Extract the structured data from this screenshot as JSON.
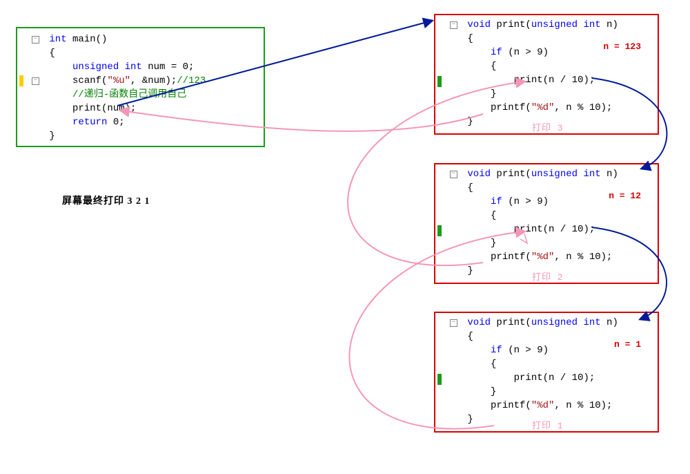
{
  "main": {
    "sig_kw": "int",
    "sig_name": " main()",
    "l_open": "{",
    "l1_a": "unsigned int",
    "l1_b": " num = 0;",
    "l2_a": "scanf",
    "l2_b": "(",
    "l2_c": "\"%u\"",
    "l2_d": ", &num);",
    "l2_e": "//123",
    "l3": "//递归-函数自己调用自己",
    "l4": "print(num);",
    "l5_a": "return",
    "l5_b": " 0;",
    "l_close": "}"
  },
  "print_fn": {
    "sig_kw1": "void",
    "sig_name": " print(",
    "sig_kw2": "unsigned int",
    "sig_tail": " n)",
    "l_open": "{",
    "l1_a": "if",
    "l1_b": " (n > 9)",
    "l2": "{",
    "l3": "print(n / 10);",
    "l4": "}",
    "l5_a": "printf(",
    "l5_b": "\"%d\"",
    "l5_c": ", n % 10);",
    "l_close": "}"
  },
  "annot": {
    "n1": "n = 123",
    "n2": "n = 12",
    "n3": "n = 1",
    "p1": "打印 3",
    "p2": "打印 2",
    "p3": "打印 1",
    "final": "屏幕最终打印 3 2 1"
  },
  "fold_glyph": "−",
  "colors": {
    "green_border": "#1a9b1a",
    "red_border": "#d90000",
    "blue_arrow": "#001a99",
    "pink_arrow": "#f497b6"
  }
}
